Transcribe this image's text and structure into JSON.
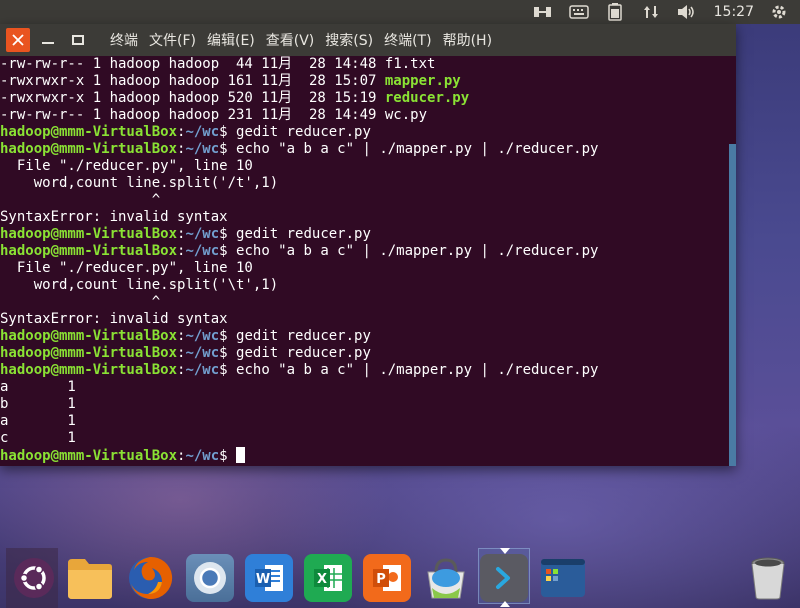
{
  "top_panel": {
    "icons": [
      "network-icon",
      "keyboard-icon",
      "battery-icon",
      "sort-icon",
      "volume-icon"
    ],
    "clock": "15:27"
  },
  "terminal": {
    "menu": [
      "终端",
      "文件(F)",
      "编辑(E)",
      "查看(V)",
      "搜索(S)",
      "终端(T)",
      "帮助(H)"
    ],
    "prompt_user": "hadoop@mmm-VirtualBox",
    "prompt_path": "~/wc",
    "lines": {
      "l1": {
        "text": "-rw-rw-r-- 1 hadoop hadoop  44 11月  28 14:48 f1.txt"
      },
      "l2": {
        "text": "-rwxrwxr-x 1 hadoop hadoop 161 11月  28 15:07 ",
        "file": "mapper.py"
      },
      "l3": {
        "text": "-rwxrwxr-x 1 hadoop hadoop 520 11月  28 15:19 ",
        "file": "reducer.py"
      },
      "l4": {
        "text": "-rw-rw-r-- 1 hadoop hadoop 231 11月  28 14:49 wc.py"
      },
      "l5": {
        "cmd": "gedit reducer.py"
      },
      "l6": {
        "cmd": "echo \"a b a c\" | ./mapper.py | ./reducer.py"
      },
      "l7": {
        "text": "  File \"./reducer.py\", line 10"
      },
      "l8": {
        "text": "    word,count line.split('/t',1)"
      },
      "l9": {
        "text": "                  ^"
      },
      "l10": {
        "text": "SyntaxError: invalid syntax"
      },
      "l11": {
        "cmd": "gedit reducer.py"
      },
      "l12": {
        "cmd": "echo \"a b a c\" | ./mapper.py | ./reducer.py"
      },
      "l13": {
        "text": "  File \"./reducer.py\", line 10"
      },
      "l14": {
        "text": "    word,count line.split('\\t',1)"
      },
      "l15": {
        "text": "                  ^"
      },
      "l16": {
        "text": "SyntaxError: invalid syntax"
      },
      "l17": {
        "cmd": "gedit reducer.py"
      },
      "l18": {
        "cmd": "gedit reducer.py"
      },
      "l19": {
        "cmd": "echo \"a b a c\" | ./mapper.py | ./reducer.py"
      },
      "l20": {
        "text": "a       1"
      },
      "l21": {
        "text": "b       1"
      },
      "l22": {
        "text": "a       1"
      },
      "l23": {
        "text": "c       1"
      },
      "l24": {
        "cmd": ""
      }
    }
  },
  "dock": {
    "items": [
      {
        "id": "ubuntu-logo",
        "label": "Ubuntu"
      },
      {
        "id": "files",
        "label": "Files"
      },
      {
        "id": "firefox",
        "label": "Firefox"
      },
      {
        "id": "chromium",
        "label": "Chromium"
      },
      {
        "id": "wps-writer",
        "label": "W"
      },
      {
        "id": "wps-spreadsheets",
        "label": "X"
      },
      {
        "id": "wps-presentation",
        "label": "P"
      },
      {
        "id": "software-center",
        "label": "Software"
      },
      {
        "id": "terminal",
        "label": ">"
      },
      {
        "id": "workspaces",
        "label": "Workspaces"
      },
      {
        "id": "trash",
        "label": "Trash"
      }
    ]
  },
  "colors": {
    "terminal_bg": "#300a24",
    "prompt_green": "#8ae234",
    "prompt_blue": "#729fcf",
    "ubuntu_orange": "#e95420",
    "panel": "#3c3b37"
  }
}
